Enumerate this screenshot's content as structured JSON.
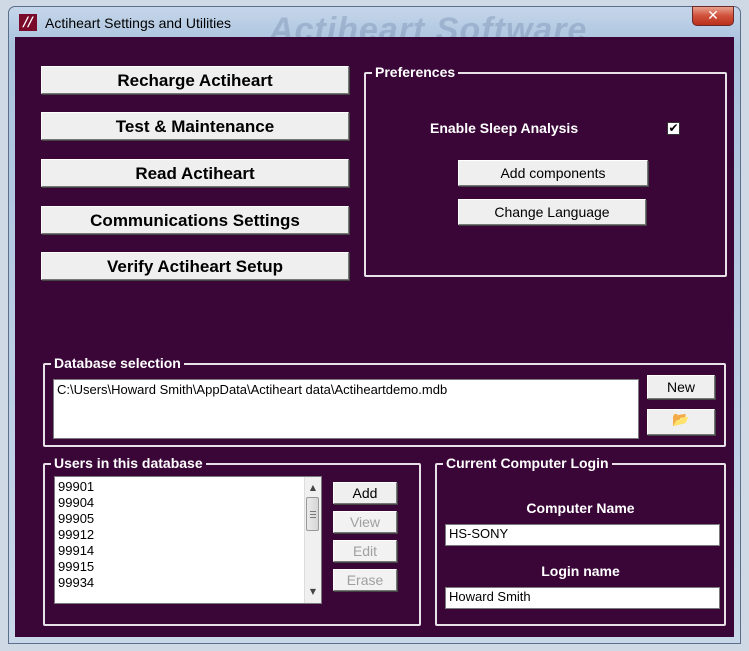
{
  "window": {
    "title": "Actiheart Settings and Utilities",
    "watermark": "Actiheart Software",
    "close_glyph": "✕"
  },
  "main_buttons": [
    {
      "label": "Recharge Actiheart"
    },
    {
      "label": "Test & Maintenance"
    },
    {
      "label": "Read Actiheart"
    },
    {
      "label": "Communications Settings"
    },
    {
      "label": "Verify Actiheart Setup"
    }
  ],
  "preferences": {
    "title": "Preferences",
    "sleep_label": "Enable Sleep Analysis",
    "sleep_checked_glyph": "✔",
    "add_components": "Add components",
    "change_language": "Change Language"
  },
  "database": {
    "title": "Database selection",
    "path": "C:\\Users\\Howard Smith\\AppData\\Actiheart data\\Actiheartdemo.mdb",
    "new_label": "New",
    "browse_icon": "folder-icon"
  },
  "users": {
    "title": "Users in this database",
    "items": [
      "99901",
      "99904",
      "99905",
      "99912",
      "99914",
      "99915",
      "99934"
    ],
    "add": "Add",
    "view": "View",
    "edit": "Edit",
    "erase": "Erase"
  },
  "login": {
    "title": "Current Computer Login",
    "computer_name_label": "Computer Name",
    "computer_name": "HS-SONY",
    "login_name_label": "Login name",
    "login_name": "Howard Smith"
  }
}
